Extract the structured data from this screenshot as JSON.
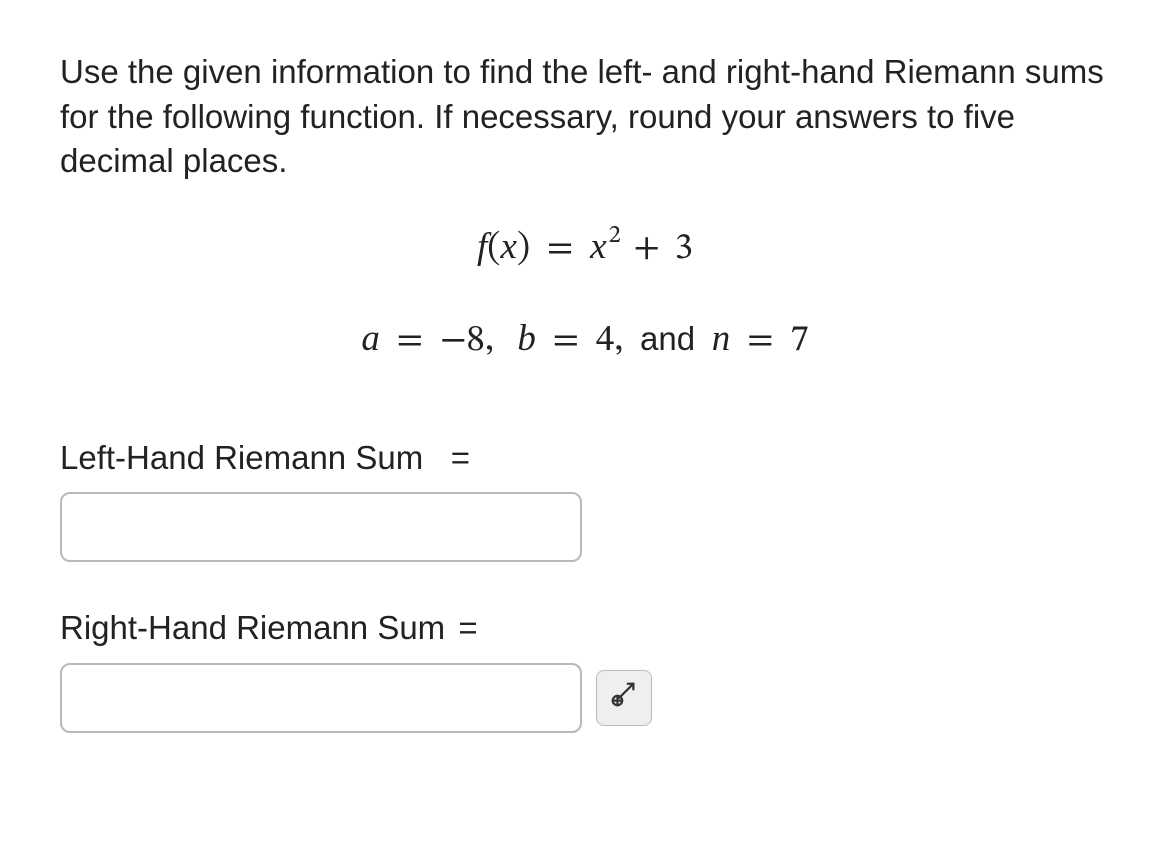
{
  "prompt": "Use the given information to find the left- and right-hand Riemann sums for the following function. If necessary, round your answers to five decimal places.",
  "function": {
    "lhs_f": "f",
    "lhs_open": "(",
    "lhs_var": "x",
    "lhs_close": ")",
    "eq": "=",
    "rhs_var": "x",
    "rhs_exp": "2",
    "plus": "+",
    "rhs_const": "3"
  },
  "params": {
    "a_sym": "a",
    "a_val": "−8",
    "b_sym": "b",
    "b_val": "4",
    "n_sym": "n",
    "n_val": "7",
    "eq": "=",
    "comma": ",",
    "and": "and"
  },
  "left": {
    "label": "Left-Hand Riemann Sum",
    "equals": "=",
    "value": ""
  },
  "right": {
    "label": "Right-Hand Riemann Sum",
    "equals": "=",
    "value": ""
  }
}
